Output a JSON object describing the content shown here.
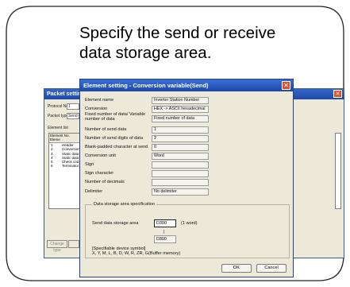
{
  "caption": {
    "line1": "Specify the send or receive",
    "line2": "data storage area."
  },
  "packet_window": {
    "title": "Packet setting",
    "protocol_label": "Protocol No.",
    "protocol_value": "1",
    "packet_type_label": "Packet type",
    "packet_type_value": "Send",
    "element_list_label": "Element list",
    "header_no": "Element No.",
    "header_elem": "Eleme",
    "rows": [
      {
        "no": "1",
        "elem": "Header"
      },
      {
        "no": "2",
        "elem": "Conversion"
      },
      {
        "no": "3",
        "elem": "Static data"
      },
      {
        "no": "4",
        "elem": "Static data"
      },
      {
        "no": "5",
        "elem": "Check cod"
      },
      {
        "no": "6",
        "elem": "Terminator"
      }
    ],
    "change_type_button": "Change type"
  },
  "dialog": {
    "title": "Element setting - Conversion variable(Send)",
    "close_glyph": "✕",
    "fields": [
      {
        "label": "Element name",
        "value": "Inverter Station Number"
      },
      {
        "label": "Conversion",
        "value": "HEX -> ASCII hexadecimal"
      },
      {
        "label": "Fixed number of data/ Variable number of data",
        "value": "Fixed number of data"
      },
      {
        "label": "Number of send data",
        "value": "1"
      },
      {
        "label": "Number of send digits of data",
        "value": "2"
      },
      {
        "label": "Blank-padded character at send",
        "value": "0"
      },
      {
        "label": "Conversion unit",
        "value": "Word"
      },
      {
        "label": "Sign",
        "value": ""
      },
      {
        "label": "Sign character",
        "value": ""
      },
      {
        "label": "Number of decimals",
        "value": ""
      },
      {
        "label": "Delimiter",
        "value": "No delimiter"
      }
    ],
    "group_title": "Data storage area specification",
    "storage_label": "Send data storage area",
    "storage_value": "D300",
    "storage_unit": "(1 word)",
    "range_sep": "|",
    "range_end": "D300",
    "note_line1": "[Specifiable device symbol]",
    "note_line2": "X, Y, M, L, B, D, W, R, ZR, G(Buffer memory)",
    "ok": "OK",
    "cancel": "Cancel"
  }
}
